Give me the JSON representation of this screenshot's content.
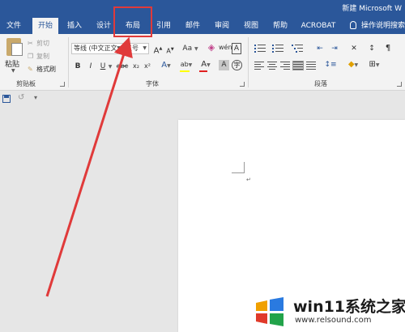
{
  "window": {
    "title": "新建 Microsoft W"
  },
  "tabs": [
    {
      "id": "file",
      "label": "文件"
    },
    {
      "id": "home",
      "label": "开始",
      "active": true
    },
    {
      "id": "insert",
      "label": "插入"
    },
    {
      "id": "design",
      "label": "设计"
    },
    {
      "id": "layout",
      "label": "布局",
      "highlighted": true
    },
    {
      "id": "references",
      "label": "引用"
    },
    {
      "id": "mailings",
      "label": "邮件"
    },
    {
      "id": "review",
      "label": "审阅"
    },
    {
      "id": "view",
      "label": "视图"
    },
    {
      "id": "help",
      "label": "帮助"
    },
    {
      "id": "acrobat",
      "label": "ACROBAT"
    }
  ],
  "tell_me": "操作说明搜索",
  "clipboard": {
    "paste": "粘贴",
    "cut": "剪切",
    "copy": "复制",
    "format_painter": "格式刷",
    "group_label": "剪贴板"
  },
  "font": {
    "font_name": "等线 (中文正文",
    "font_size": "五号",
    "group_label": "字体",
    "grow": "A",
    "shrink": "A",
    "change_case": "Aa",
    "bold": "B",
    "italic": "I",
    "underline": "U",
    "strikethrough": "abc",
    "subscript": "x₂",
    "superscript": "x²",
    "text_effects": "A",
    "highlight": "ab",
    "font_color": "A",
    "char_shading": "A",
    "char_border": "A",
    "phonetic": "wén"
  },
  "paragraph": {
    "group_label": "段落"
  },
  "colors": {
    "ribbon_blue": "#2b579a",
    "annotation_red": "#e03a3a",
    "highlight_yellow": "#ffff00",
    "font_color_red": "#e02020"
  },
  "watermark": {
    "title": "win11系统之家",
    "url": "www.relsound.com"
  }
}
